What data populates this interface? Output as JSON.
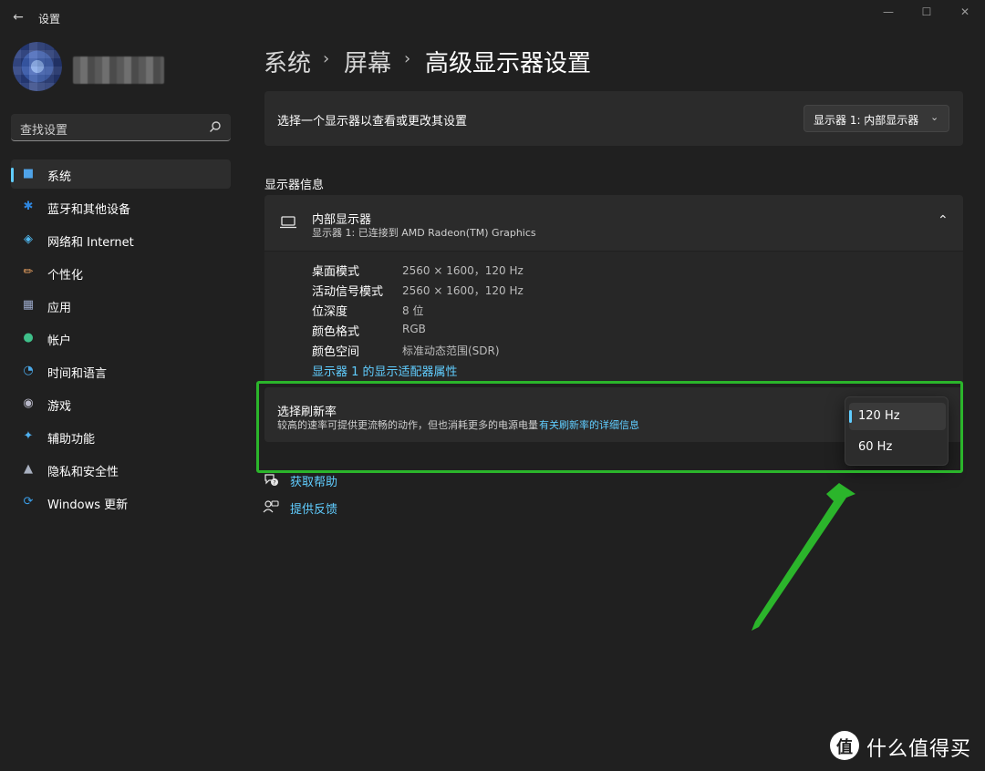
{
  "window": {
    "title": "设置",
    "controls": [
      "minimize-icon",
      "maximize-icon",
      "close-icon"
    ]
  },
  "search": {
    "placeholder": "查找设置"
  },
  "sidebar": {
    "items": [
      {
        "label": "系统",
        "icon": "monitor-icon",
        "icon_color": "#4fa3e8",
        "active": true
      },
      {
        "label": "蓝牙和其他设备",
        "icon": "bluetooth-icon",
        "icon_color": "#2f87e0"
      },
      {
        "label": "网络和 Internet",
        "icon": "wifi-icon",
        "icon_color": "#4fb8f0"
      },
      {
        "label": "个性化",
        "icon": "brush-icon",
        "icon_color": "#e8a060"
      },
      {
        "label": "应用",
        "icon": "apps-icon",
        "icon_color": "#9aa8c8"
      },
      {
        "label": "帐户",
        "icon": "person-icon",
        "icon_color": "#3fc08a"
      },
      {
        "label": "时间和语言",
        "icon": "globe-clock-icon",
        "icon_color": "#4aa8e8"
      },
      {
        "label": "游戏",
        "icon": "gamepad-icon",
        "icon_color": "#b8b8c8"
      },
      {
        "label": "辅助功能",
        "icon": "accessibility-icon",
        "icon_color": "#4fb0f0"
      },
      {
        "label": "隐私和安全性",
        "icon": "shield-icon",
        "icon_color": "#a8b0c0"
      },
      {
        "label": "Windows 更新",
        "icon": "update-icon",
        "icon_color": "#3a9ee8"
      }
    ]
  },
  "breadcrumb": [
    "系统",
    "屏幕",
    "高级显示器设置"
  ],
  "display_select": {
    "label": "选择一个显示器以查看或更改其设置",
    "value": "显示器 1: 内部显示器"
  },
  "info_section": {
    "heading": "显示器信息",
    "display_name": "内部显示器",
    "display_sub": "显示器 1: 已连接到 AMD Radeon(TM) Graphics",
    "rows": [
      {
        "label": "桌面模式",
        "value": "2560 × 1600，120 Hz"
      },
      {
        "label": "活动信号模式",
        "value": "2560 × 1600，120 Hz"
      },
      {
        "label": "位深度",
        "value": "8 位"
      },
      {
        "label": "颜色格式",
        "value": "RGB"
      },
      {
        "label": "颜色空间",
        "value": "标准动态范围(SDR)"
      }
    ],
    "adapter_link": "显示器 1 的显示适配器属性"
  },
  "refresh": {
    "title": "选择刷新率",
    "desc": "较高的速率可提供更流畅的动作，但也消耗更多的电源电量",
    "link": "有关刷新率的详细信息",
    "options": [
      "120 Hz",
      "60 Hz"
    ],
    "selected": "120 Hz"
  },
  "help": {
    "get_help": "获取帮助",
    "feedback": "提供反馈"
  },
  "watermark": {
    "text": "什么值得买",
    "logo_glyph": "值"
  },
  "colors": {
    "accent": "#60cdff",
    "highlight": "#2bb52b",
    "background": "#202020",
    "card": "#2b2b2b"
  }
}
